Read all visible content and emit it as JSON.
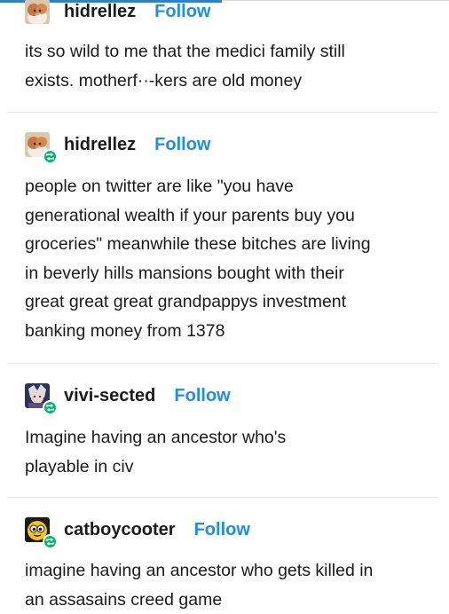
{
  "posts": [
    {
      "username": "hidrellez",
      "follow_label": "Follow",
      "avatar_icon": "cat-avatar-icon",
      "reblogged": false,
      "body": "its so wild to me that the medici family still\nexists. motherf··-kers are old money"
    },
    {
      "username": "hidrellez",
      "follow_label": "Follow",
      "avatar_icon": "cat-avatar-icon",
      "reblogged": true,
      "body": "people on twitter are like \"you have\ngenerational wealth if your parents buy you\ngroceries\" meanwhile these bitches are living\nin beverly hills mansions bought with their\ngreat great great grandpappys investment\nbanking money from 1378"
    },
    {
      "username": "vivi-sected",
      "follow_label": "Follow",
      "avatar_icon": "character-avatar-icon",
      "reblogged": true,
      "body": "Imagine having an ancestor who's\nplayable in civ"
    },
    {
      "username": "catboycooter",
      "follow_label": "Follow",
      "avatar_icon": "cartoon-face-avatar-icon",
      "reblogged": true,
      "body": "imagine having an ancestor who gets killed in\nan assasains creed game"
    }
  ],
  "colors": {
    "follow": "#1e8de8",
    "reblog_badge": "#00b86b",
    "divider": "#e6e6e6",
    "text": "#1a1a1a"
  }
}
